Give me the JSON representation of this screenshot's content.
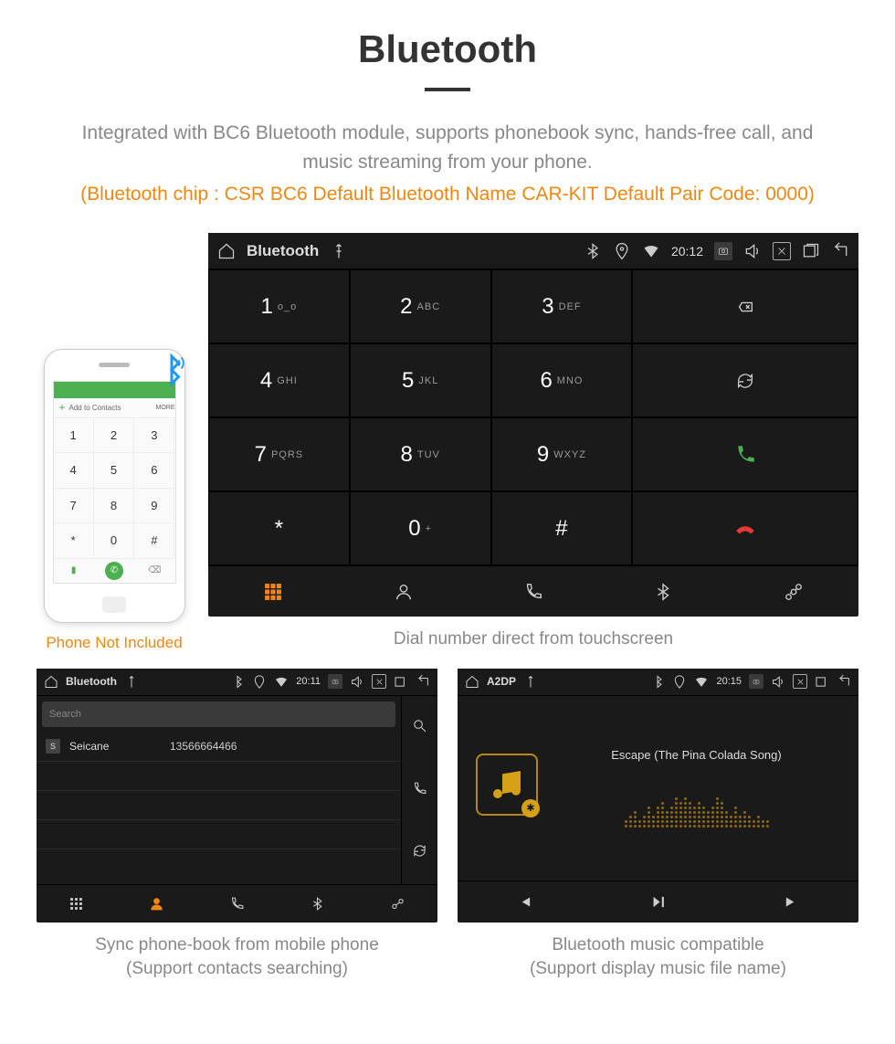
{
  "title": "Bluetooth",
  "description": "Integrated with BC6 Bluetooth module, supports phonebook sync, hands-free call, and music streaming from your phone.",
  "specs": "(Bluetooth chip : CSR BC6     Default Bluetooth Name CAR-KIT     Default Pair Code: 0000)",
  "phone": {
    "add_contacts": "Add to Contacts",
    "more": "MORE",
    "caption": "Phone Not Included",
    "keys": [
      "1",
      "2",
      "3",
      "4",
      "5",
      "6",
      "7",
      "8",
      "9",
      "*",
      "0",
      "#"
    ]
  },
  "dialer": {
    "status_title": "Bluetooth",
    "time": "20:12",
    "keys": [
      {
        "n": "1",
        "s": "o_o"
      },
      {
        "n": "2",
        "s": "ABC"
      },
      {
        "n": "3",
        "s": "DEF"
      },
      {
        "n": "4",
        "s": "GHI"
      },
      {
        "n": "5",
        "s": "JKL"
      },
      {
        "n": "6",
        "s": "MNO"
      },
      {
        "n": "7",
        "s": "PQRS"
      },
      {
        "n": "8",
        "s": "TUV"
      },
      {
        "n": "9",
        "s": "WXYZ"
      },
      {
        "n": "*",
        "s": ""
      },
      {
        "n": "0",
        "s": "+",
        "sup": true
      },
      {
        "n": "#",
        "s": ""
      }
    ],
    "caption": "Dial number direct from touchscreen"
  },
  "contacts": {
    "status_title": "Bluetooth",
    "time": "20:11",
    "search_placeholder": "Search",
    "entries": [
      {
        "badge": "S",
        "name": "Seicane",
        "number": "13566664466"
      }
    ],
    "caption_l1": "Sync phone-book from mobile phone",
    "caption_l2": "(Support contacts searching)"
  },
  "music": {
    "status_title": "A2DP",
    "time": "20:15",
    "track": "Escape (The Pina Colada Song)",
    "caption_l1": "Bluetooth music compatible",
    "caption_l2": "(Support display music file name)",
    "eq_heights": [
      5,
      8,
      12,
      6,
      10,
      14,
      9,
      15,
      18,
      13,
      16,
      20,
      17,
      22,
      19,
      14,
      18,
      15,
      11,
      16,
      20,
      17,
      13,
      10,
      14,
      9,
      12,
      8,
      6,
      10,
      7,
      5
    ]
  }
}
